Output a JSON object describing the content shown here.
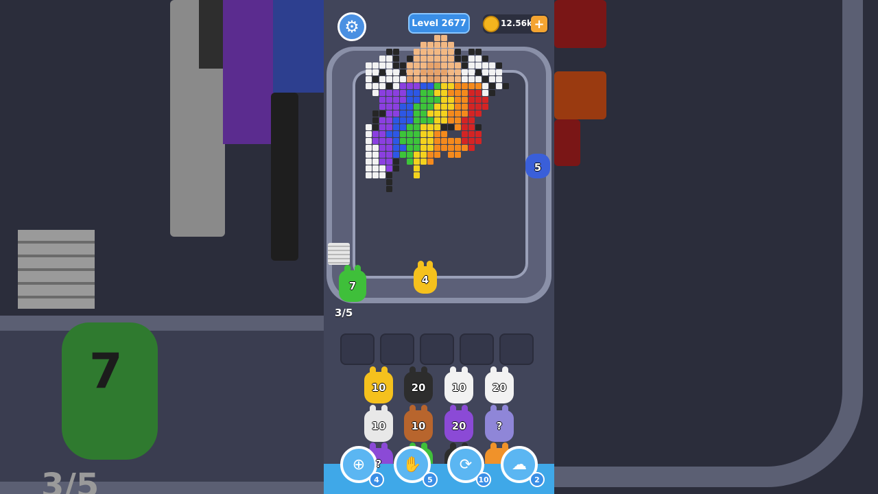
{
  "header": {
    "level_label": "Level 2677",
    "coins": "12.56k"
  },
  "lane": {
    "counter": "3/5"
  },
  "conveyor_bunnies": [
    {
      "color": "#3fbf3a",
      "value": "7"
    },
    {
      "color": "#f5c11d",
      "value": "4"
    },
    {
      "color": "#3a5fd9",
      "value": "5"
    }
  ],
  "queue_rows": [
    [
      {
        "color": "#f5c11d",
        "value": "10"
      },
      {
        "color": "#2d2d2d",
        "value": "20"
      },
      {
        "color": "#f2f2f2",
        "value": "10"
      },
      {
        "color": "#f2f2f2",
        "value": "20"
      }
    ],
    [
      {
        "color": "#e8e8e8",
        "value": "10"
      },
      {
        "color": "#b8652d",
        "value": "10"
      },
      {
        "color": "#8b4ad6",
        "value": "20"
      },
      {
        "color": "#8f86d8",
        "value": "?"
      }
    ],
    [
      {
        "color": "#8b4ad6",
        "value": "?"
      },
      {
        "color": "#3fbf3a",
        "value": ""
      },
      {
        "color": "#2d2d2d",
        "value": ""
      },
      {
        "color": "#f0922a",
        "value": ""
      }
    ]
  ],
  "boosters": [
    {
      "icon": "add-slot-icon",
      "count": "4"
    },
    {
      "icon": "hand-icon",
      "count": "5"
    },
    {
      "icon": "shuffle-icon",
      "count": "10"
    },
    {
      "icon": "bunny-clear-icon",
      "count": "2"
    }
  ],
  "colors": {
    "accent": "#3a8ee6",
    "board": "#3f4255",
    "track": "#8a90a8"
  }
}
